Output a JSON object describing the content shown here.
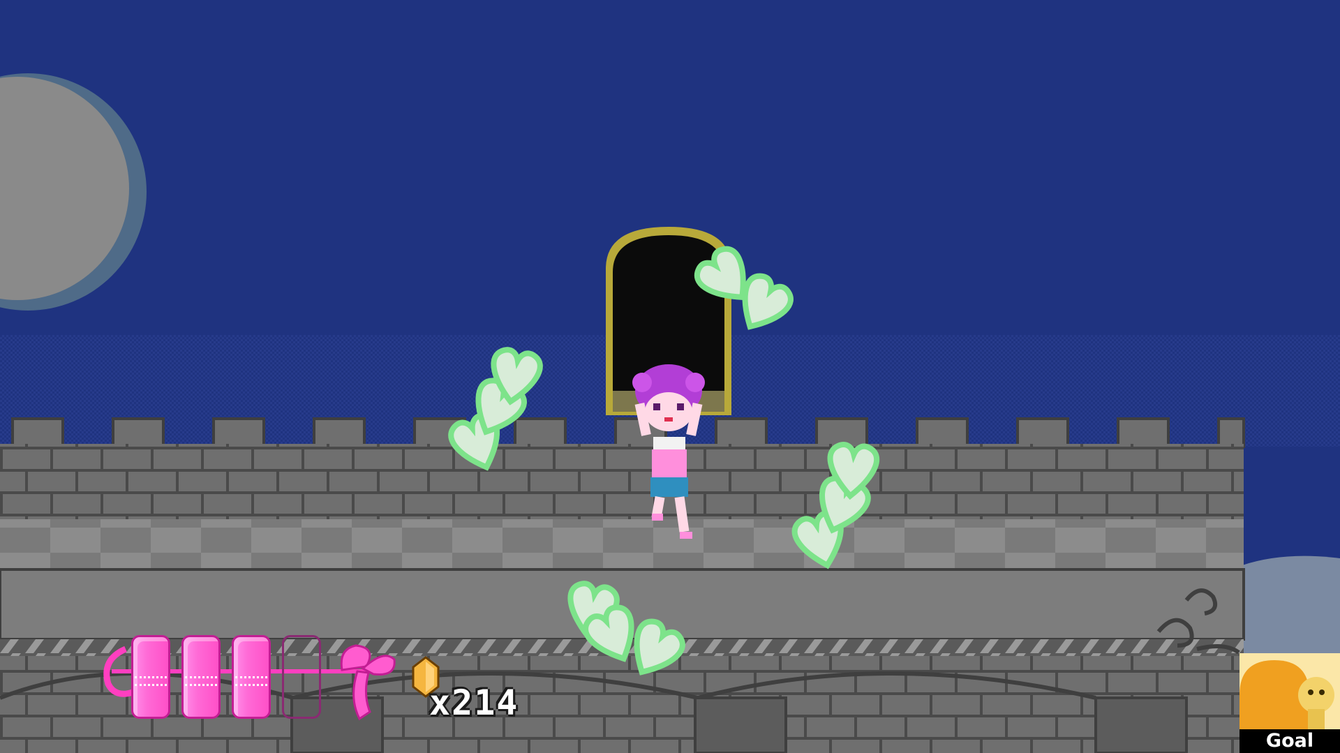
{
  "scene": {
    "name": "castle-rampart-night",
    "colors": {
      "sky": "#1f3380",
      "moon": "#8a8a8a",
      "moon_ring": "#4f6b88",
      "wall": "#6f6f6f",
      "wall_dark": "#4a4a4a",
      "brick_line": "#454545",
      "door_frame": "#b8a93a",
      "door_inner": "#0b0b0b",
      "heart_fill": "#d8ecd8",
      "heart_glow": "#7de38a",
      "heart_outline": "#1f5a2a"
    },
    "hazards": [
      {
        "type": "heart-cluster",
        "icon": "green-heart-icon",
        "count": 3
      },
      {
        "type": "heart-cluster",
        "icon": "green-heart-icon",
        "count": 3
      },
      {
        "type": "heart-cluster",
        "icon": "green-heart-icon",
        "count": 3
      },
      {
        "type": "heart-cluster",
        "icon": "green-heart-icon",
        "count": 3
      }
    ]
  },
  "hud": {
    "health": {
      "icon": "pink-ribbon-health-bar",
      "filled": 3,
      "max": 4,
      "color": "#ff6ad6"
    },
    "gems": {
      "icon": "amber-gem-icon",
      "count_label": "x214",
      "count": 214
    },
    "goal": {
      "label": "Goal",
      "icon": "goal-portrait-icon",
      "accent": "#f0a020"
    }
  }
}
